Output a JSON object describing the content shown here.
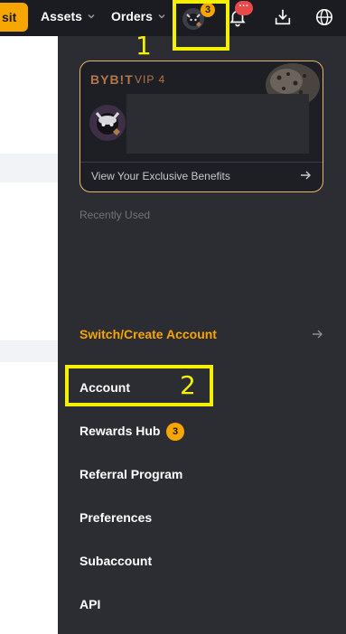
{
  "header": {
    "deposit_label": "sit",
    "nav": {
      "assets": "Assets",
      "orders": "Orders"
    },
    "profile_badge": "3",
    "notifications_badge": "···"
  },
  "vip_card": {
    "logo_text": "BYB!T",
    "level": "VIP 4",
    "benefits_link": "View Your Exclusive Benefits"
  },
  "recently_used": {
    "title": "Recently Used"
  },
  "switch_account": {
    "label": "Switch/Create Account"
  },
  "menu": [
    {
      "label": "Account"
    },
    {
      "label": "Rewards Hub",
      "badge": "3"
    },
    {
      "label": "Referral Program"
    },
    {
      "label": "Preferences"
    },
    {
      "label": "Subaccount"
    },
    {
      "label": "API"
    }
  ],
  "annotations": {
    "step1": "1",
    "step2": "2"
  },
  "colors": {
    "accent": "#f7a600",
    "panel_bg": "#2b2d33",
    "header_bg": "#1a1c21",
    "highlight": "#f4f000",
    "vip_border": "#e8b56f",
    "danger": "#e84a4a"
  },
  "icons": [
    "chevron-down-icon",
    "bell-icon",
    "download-icon",
    "globe-icon",
    "arrow-right-icon",
    "avatar-icon"
  ]
}
